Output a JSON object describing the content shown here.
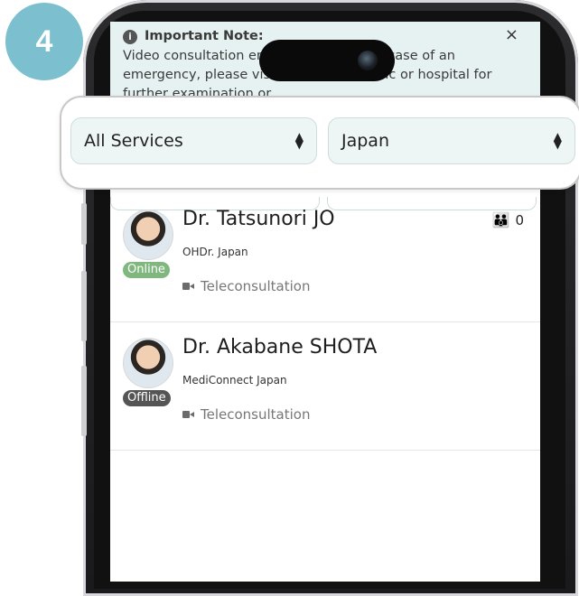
{
  "step": {
    "number": "4"
  },
  "note": {
    "title": "Important Note:",
    "close": "×",
    "body": "Video consultation                         emergency cases. In case of an emergency, please visit the nearest clinic or hospital for further examination or"
  },
  "filters": {
    "service": "All Services",
    "country": "Japan"
  },
  "doctors": [
    {
      "name": "Dr. Tatsunori JO",
      "org": "OHDr. Japan",
      "status": "Online",
      "service": "Teleconsultation",
      "family_count": "0"
    },
    {
      "name": "Dr. Akabane SHOTA",
      "org": "MediConnect Japan",
      "status": "Offline",
      "service": "Teleconsultation"
    }
  ],
  "colors": {
    "step_badge": "#7cc0cf",
    "online": "#7fb77e",
    "offline": "#555555",
    "note_bg": "#e6f2f2",
    "family_icon": "#d23c7a"
  },
  "icons": {
    "info": "info-icon",
    "close": "close-icon",
    "select_arrows": "updown-arrows-icon",
    "video": "video-camera-icon",
    "family": "family-icon"
  }
}
